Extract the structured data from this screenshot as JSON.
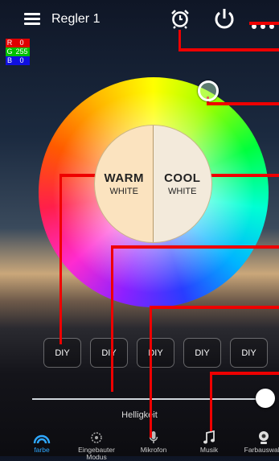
{
  "header": {
    "title": "Regler 1"
  },
  "rgb": [
    {
      "key": "R",
      "value": "0",
      "color": "#e00000"
    },
    {
      "key": "G",
      "value": "255",
      "color": "#00c000"
    },
    {
      "key": "B",
      "value": "0",
      "color": "#1010e0"
    }
  ],
  "wheel": {
    "warm": {
      "label": "WARM",
      "sub": "WHITE"
    },
    "cool": {
      "label": "COOL",
      "sub": "WHITE"
    }
  },
  "diy": [
    "DIY",
    "DIY",
    "DIY",
    "DIY",
    "DIY"
  ],
  "brightness": {
    "label": "Helligkeit",
    "level": 0.97
  },
  "nav": [
    {
      "label": "farbe",
      "icon": "color-wave-icon",
      "active": true
    },
    {
      "label": "Eingebauter Modus",
      "icon": "built-in-mode-icon",
      "active": false
    },
    {
      "label": "Mikrofon",
      "icon": "microphone-icon",
      "active": false
    },
    {
      "label": "Musik",
      "icon": "music-note-icon",
      "active": false
    },
    {
      "label": "Farbauswahl",
      "icon": "camera-icon",
      "active": false
    }
  ],
  "colors": {
    "active": "#2fa8ff",
    "callout": "#e00000"
  }
}
